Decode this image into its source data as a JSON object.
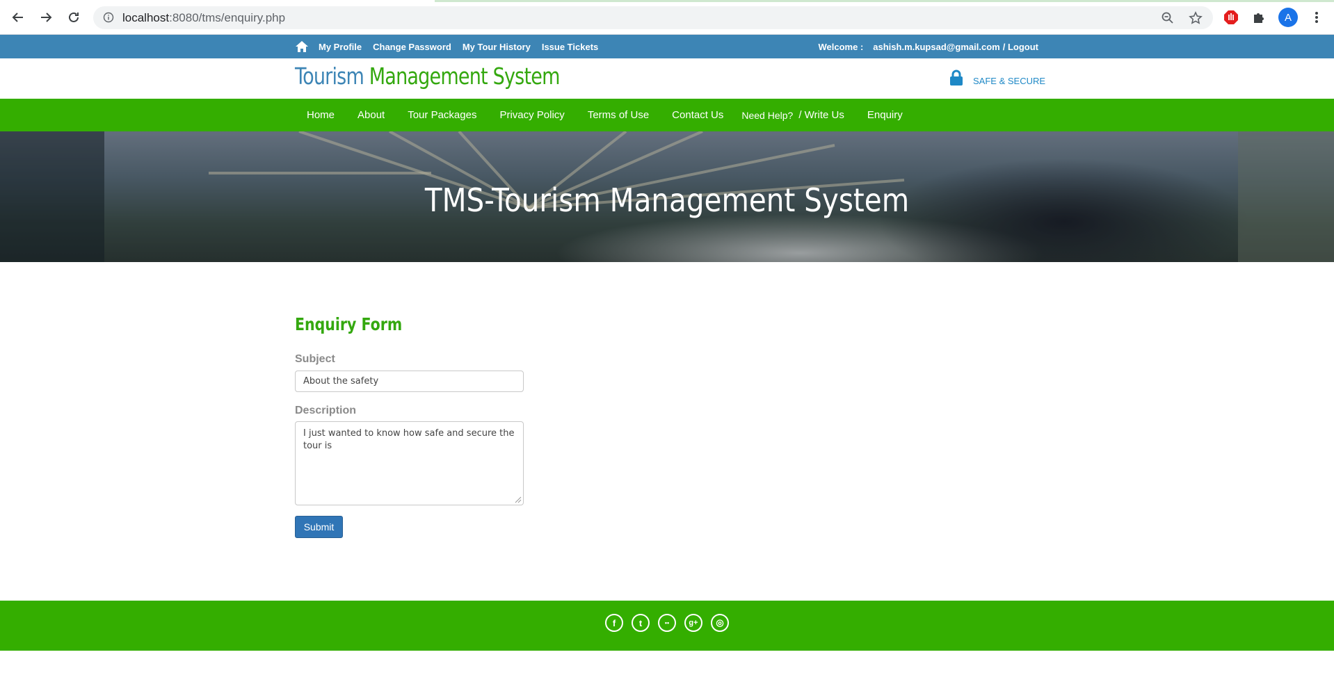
{
  "browser": {
    "url_host": "localhost",
    "url_rest": ":8080/tms/enquiry.php",
    "profile_initial": "A"
  },
  "topbar": {
    "links": [
      "My Profile",
      "Change Password",
      "My Tour History",
      "Issue Tickets"
    ],
    "welcome_label": "Welcome :",
    "user_email": "ashish.m.kupsad@gmail.com",
    "logout_label": "/ Logout"
  },
  "header": {
    "logo_part1": "Tourism",
    "logo_part2": " Management System",
    "secure_label": "SAFE & SECURE"
  },
  "nav": {
    "items": [
      "Home",
      "About",
      "Tour Packages",
      "Privacy Policy",
      "Terms of Use",
      "Contact Us"
    ],
    "help_label": "Need Help?",
    "write_label": "/ Write Us",
    "enquiry_label": "Enquiry"
  },
  "banner": {
    "title": "TMS-Tourism Management System"
  },
  "form": {
    "title": "Enquiry Form",
    "subject_label": "Subject",
    "subject_value": "About the safety",
    "description_label": "Description",
    "description_value": "I just wanted to know how safe and secure the tour is",
    "submit_label": "Submit"
  },
  "footer": {
    "social_icons": [
      "facebook-icon",
      "twitter-icon",
      "flickr-icon",
      "google-plus-icon",
      "dribbble-icon"
    ],
    "social_glyphs": [
      "f",
      "t",
      "••",
      "g+",
      "◎"
    ]
  },
  "colors": {
    "top_strip": "#3d85b5",
    "brand_green": "#34ae00",
    "brand_blue": "#3d85b5",
    "submit_blue": "#3075b6"
  }
}
